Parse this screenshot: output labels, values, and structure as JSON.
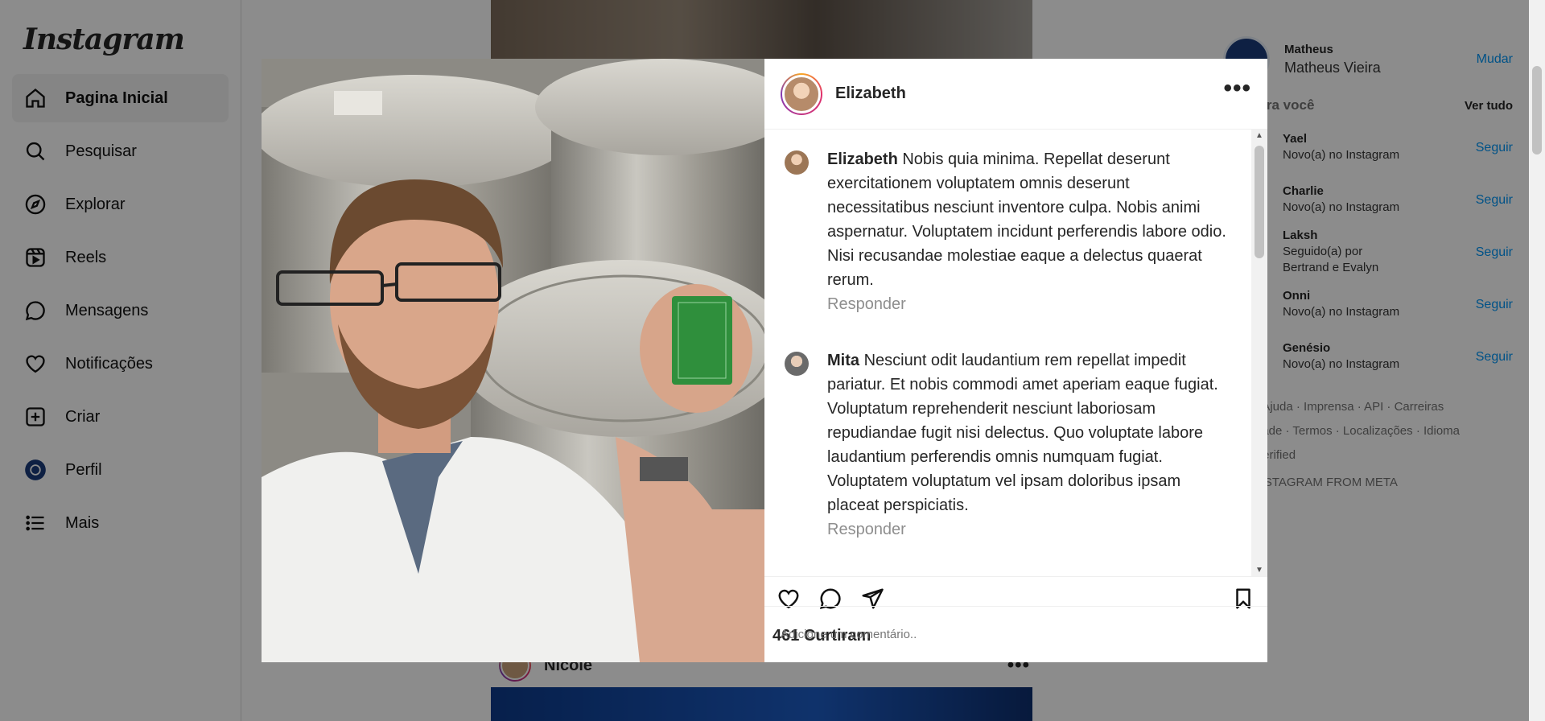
{
  "sidebar": {
    "logo": "Instagram",
    "items": [
      {
        "label": "Pagina Inicial",
        "icon": "home-icon"
      },
      {
        "label": "Pesquisar",
        "icon": "search-icon"
      },
      {
        "label": "Explorar",
        "icon": "compass-icon"
      },
      {
        "label": "Reels",
        "icon": "reels-icon"
      },
      {
        "label": "Mensagens",
        "icon": "message-icon"
      },
      {
        "label": "Notificações",
        "icon": "heart-icon"
      },
      {
        "label": "Criar",
        "icon": "plus-square-icon"
      },
      {
        "label": "Perfil",
        "icon": "avatar-icon"
      },
      {
        "label": "Mais",
        "icon": "menu-icon"
      }
    ]
  },
  "feed": {
    "post_author": "Nicole",
    "more": "•••"
  },
  "right": {
    "username": "Matheus",
    "fullname": "Matheus Vieira",
    "switch": "Mudar",
    "suggestions_title": "ões para você",
    "see_all": "Ver tudo",
    "suggestions": [
      {
        "name": "Yael",
        "sub": "Novo(a) no Instagram",
        "follow": "Seguir"
      },
      {
        "name": "Charlie",
        "sub": "Novo(a) no Instagram",
        "follow": "Seguir"
      },
      {
        "name": "Laksh",
        "sub": "Seguido(a) por Bertrand e Evalyn",
        "follow": "Seguir"
      },
      {
        "name": "Onni",
        "sub": "Novo(a) no Instagram",
        "follow": "Seguir"
      },
      {
        "name": "Genésio",
        "sub": "Novo(a) no Instagram",
        "follow": "Seguir"
      }
    ],
    "footer_line1": "· Ajuda · Imprensa · API · Carreiras",
    "footer_line2": "dade · Termos · Localizações · Idioma",
    "footer_line3": "Verified",
    "footer_meta": "NSTAGRAM FROM META"
  },
  "modal": {
    "author": "Elizabeth",
    "more": "•••",
    "comments": [
      {
        "user": "Elizabeth",
        "text": "Nobis quia minima. Repellat deserunt exercitationem voluptatem omnis deserunt necessitatibus nesciunt inventore culpa. Nobis animi aspernatur. Voluptatem incidunt perferendis labore odio. Nisi recusandae molestiae eaque a delectus quaerat rerum.",
        "reply": "Responder"
      },
      {
        "user": "Mita",
        "text": "Nesciunt odit laudantium rem repellat impedit pariatur. Et nobis commodi amet aperiam eaque fugiat. Voluptatum reprehenderit nesciunt laboriosam repudiandae fugit nisi delectus. Quo voluptate labore laudantium perferendis omnis numquam fugiat. Voluptatem voluptatum vel ipsam doloribus ipsam placeat perspiciatis.",
        "reply": "Responder"
      }
    ],
    "likes": "461 Curtiram",
    "comment_placeholder": "Adicione um comentário.."
  }
}
